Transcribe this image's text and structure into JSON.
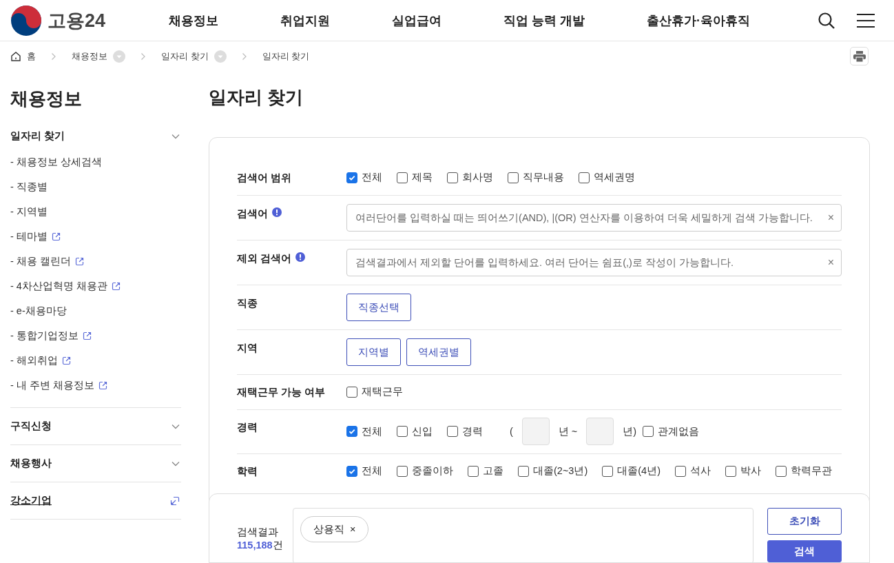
{
  "header": {
    "logo_text": "고용24",
    "nav": [
      "채용정보",
      "취업지원",
      "실업급여",
      "직업 능력 개발",
      "출산휴가·육아휴직"
    ]
  },
  "breadcrumb": [
    {
      "label": "홈",
      "kind": "home"
    },
    {
      "label": "채용정보",
      "kind": "dropdown"
    },
    {
      "label": "일자리 찾기",
      "kind": "dropdown"
    },
    {
      "label": "일자리 찾기",
      "kind": "plain"
    }
  ],
  "sidebar": {
    "title": "채용정보",
    "sections": [
      {
        "label": "일자리 찾기",
        "kind": "toggle",
        "children": [
          {
            "label": "- 채용정보 상세검색",
            "external": false
          },
          {
            "label": "- 직종별",
            "external": false
          },
          {
            "label": "- 지역별",
            "external": false
          },
          {
            "label": "- 테마별",
            "external": true
          },
          {
            "label": "- 채용 캘린더",
            "external": true
          },
          {
            "label": "- 4차산업혁명 채용관",
            "external": true
          },
          {
            "label": "- e-채용마당",
            "external": false
          },
          {
            "label": "- 통합기업정보",
            "external": true
          },
          {
            "label": "- 해외취업",
            "external": true
          },
          {
            "label": "- 내 주변 채용정보",
            "external": true
          }
        ]
      },
      {
        "label": "구직신청",
        "kind": "toggle"
      },
      {
        "label": "채용행사",
        "kind": "toggle"
      },
      {
        "label": "강소기업",
        "kind": "link"
      }
    ]
  },
  "page_title": "일자리 찾기",
  "form": {
    "rows": [
      {
        "label": "검색어 범위",
        "kind": "checks",
        "options": [
          {
            "label": "전체",
            "checked": true
          },
          {
            "label": "제목",
            "checked": false
          },
          {
            "label": "회사명",
            "checked": false
          },
          {
            "label": "직무내용",
            "checked": false
          },
          {
            "label": "역세권명",
            "checked": false
          }
        ]
      },
      {
        "label": "검색어",
        "kind": "text",
        "info": true,
        "placeholder": "여러단어를 입력하실 때는 띄어쓰기(AND), |(OR) 연산자를 이용하여 더욱 세밀하게 검색 가능합니다.",
        "clear": "×"
      },
      {
        "label": "제외 검색어",
        "kind": "text",
        "info": true,
        "placeholder": "검색결과에서 제외할 단어를 입력하세요. 여러 단어는 쉼표(,)로 작성이 가능합니다.",
        "clear": "×"
      },
      {
        "label": "직종",
        "kind": "buttons",
        "buttons": [
          "직종선택"
        ]
      },
      {
        "label": "지역",
        "kind": "buttons",
        "buttons": [
          "지역별",
          "역세권별"
        ]
      },
      {
        "label": "재택근무 가능 여부",
        "kind": "checks",
        "options": [
          {
            "label": "재택근무",
            "checked": false
          }
        ]
      },
      {
        "label": "경력",
        "kind": "career",
        "options": [
          {
            "label": "전체",
            "checked": true
          },
          {
            "label": "신입",
            "checked": false
          },
          {
            "label": "경력",
            "checked": false
          }
        ],
        "range": {
          "open": "(",
          "from_unit": "년 ~",
          "to_unit": "년)"
        },
        "extra": {
          "label": "관계없음",
          "checked": false
        }
      },
      {
        "label": "학력",
        "kind": "checks",
        "options": [
          {
            "label": "전체",
            "checked": true
          },
          {
            "label": "중졸이하",
            "checked": false
          },
          {
            "label": "고졸",
            "checked": false
          },
          {
            "label": "대졸(2~3년)",
            "checked": false
          },
          {
            "label": "대졸(4년)",
            "checked": false
          },
          {
            "label": "석사",
            "checked": false
          },
          {
            "label": "박사",
            "checked": false
          },
          {
            "label": "학력무관",
            "checked": false
          }
        ]
      }
    ]
  },
  "results": {
    "label": "검색결과",
    "count": "115,188",
    "unit": "건",
    "tags": [
      {
        "label": "상용직",
        "remove": "×"
      }
    ],
    "buttons": [
      {
        "label": "초기화",
        "kind": "outline"
      },
      {
        "label": "검색",
        "kind": "primary"
      }
    ]
  }
}
